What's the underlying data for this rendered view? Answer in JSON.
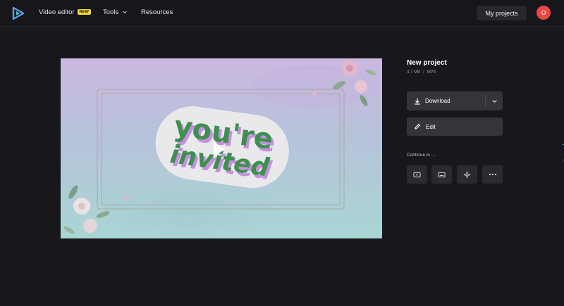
{
  "nav": {
    "video_editor": "Video editor",
    "new_badge": "NEW",
    "tools": "Tools",
    "resources": "Resources",
    "my_projects": "My projects",
    "avatar_initial": "O"
  },
  "project": {
    "title": "New project",
    "size": "4.7 MB",
    "separator": "/",
    "format": "MP4"
  },
  "actions": {
    "download": "Download",
    "edit": "Edit",
    "continue_in": "Continue in ..."
  },
  "video": {
    "headline_line1": "you're",
    "headline_line2": "invited"
  },
  "colors": {
    "background": "#17171c",
    "button": "#34343b",
    "avatar": "#e6484b",
    "badge": "#f7d631",
    "logo": "#5aa0e8",
    "text_green": "#3f8f4f",
    "text_shadow_purple": "#c58fe0"
  },
  "icons": [
    "logo-icon",
    "chevron-down-icon",
    "download-icon",
    "pencil-icon",
    "youtube-icon",
    "subtitles-icon",
    "sparkle-icon",
    "more-icon",
    "play-icon"
  ]
}
